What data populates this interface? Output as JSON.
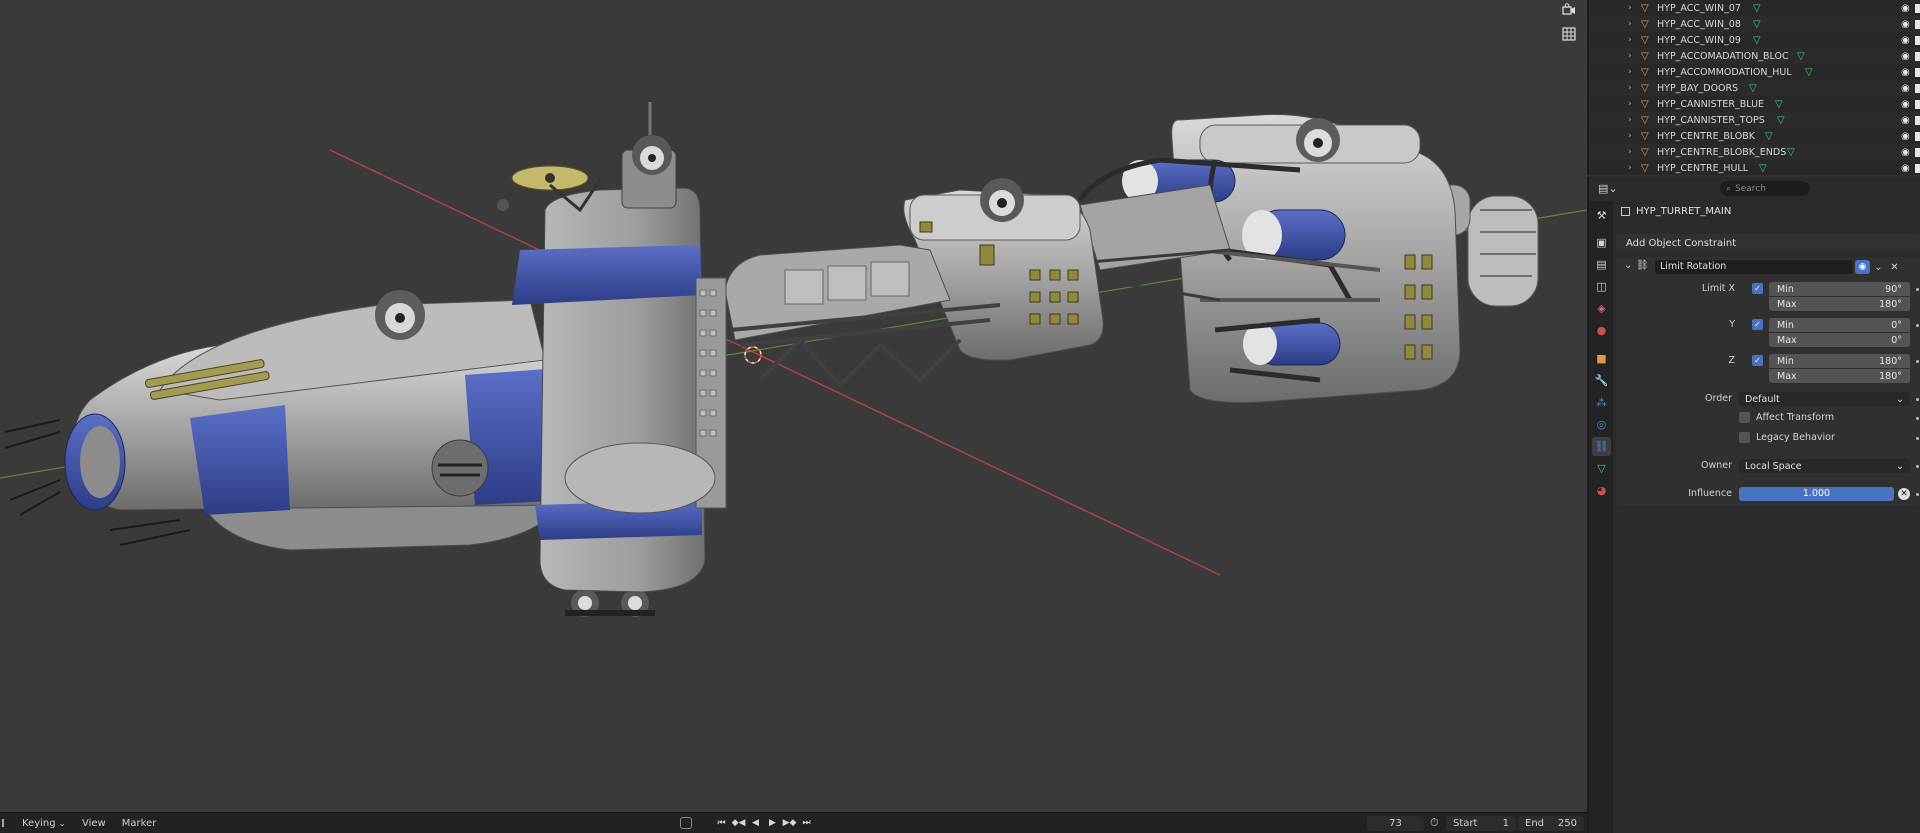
{
  "outliner": {
    "rows": [
      {
        "name": "HYP_ACC_WIN_07"
      },
      {
        "name": "HYP_ACC_WIN_08"
      },
      {
        "name": "HYP_ACC_WIN_09"
      },
      {
        "name": "HYP_ACCOMADATION_BLOC"
      },
      {
        "name": "HYP_ACCOMMODATION_HUL"
      },
      {
        "name": "HYP_BAY_DOORS"
      },
      {
        "name": "HYP_CANNISTER_BLUE"
      },
      {
        "name": "HYP_CANNISTER_TOPS"
      },
      {
        "name": "HYP_CENTRE_BLOBK"
      },
      {
        "name": "HYP_CENTRE_BLOBK_ENDS"
      },
      {
        "name": "HYP_CENTRE_HULL"
      }
    ]
  },
  "properties": {
    "search_placeholder": "Search",
    "object_name": "HYP_TURRET_MAIN",
    "add_constraint_label": "Add Object Constraint",
    "constraint": {
      "name": "Limit Rotation",
      "limit_x_label": "Limit X",
      "y_label": "Y",
      "z_label": "Z",
      "min_label": "Min",
      "max_label": "Max",
      "x_min": "90°",
      "x_max": "180°",
      "y_min": "0°",
      "y_max": "0°",
      "z_min": "180°",
      "z_max": "180°",
      "limit_x_enabled": true,
      "limit_y_enabled": true,
      "limit_z_enabled": true,
      "order_label": "Order",
      "order_value": "Default",
      "affect_transform_label": "Affect Transform",
      "affect_transform_checked": false,
      "legacy_behavior_label": "Legacy Behavior",
      "legacy_behavior_checked": false,
      "owner_label": "Owner",
      "owner_value": "Local Space",
      "influence_label": "Influence",
      "influence_value": "1.000"
    }
  },
  "timeline": {
    "keying_label": "Keying",
    "view_label": "View",
    "marker_label": "Marker",
    "current_frame": "73",
    "start_label": "Start",
    "start_value": "1",
    "end_label": "End",
    "end_value": "250"
  },
  "colors": {
    "accent_blue": "#4673c2",
    "object_orange": "#e8964a",
    "mesh_green": "#35d17c",
    "hull_blue": "#3d4fa6",
    "hull_grey": "#a9a9a9"
  }
}
